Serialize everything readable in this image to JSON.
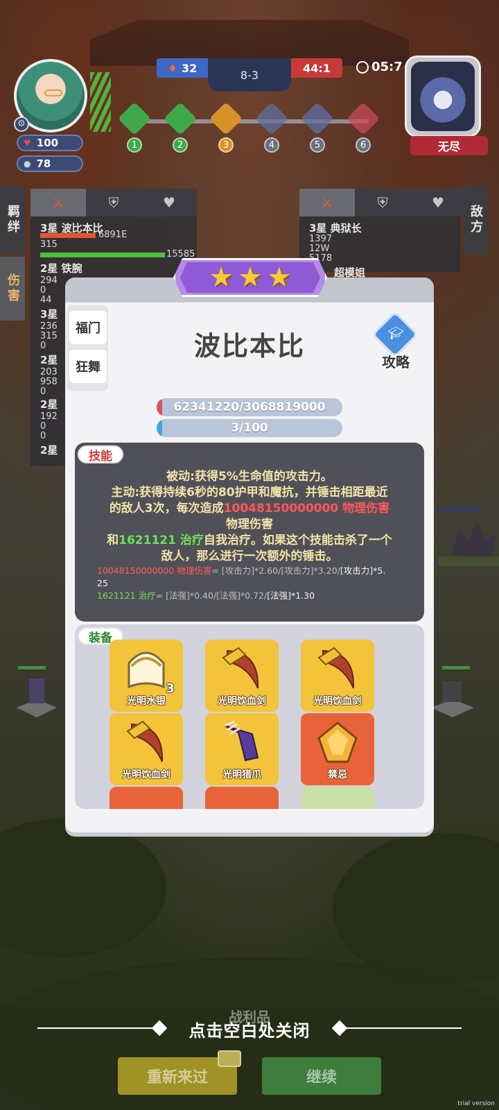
{
  "hud": {
    "player": {
      "hp": "100",
      "coins": "78"
    },
    "score": {
      "left": "32",
      "round": "8-3",
      "right": "44:1"
    },
    "timer": "05:7",
    "stages": [
      {
        "num": "1",
        "color": "#3fa84a",
        "done": true
      },
      {
        "num": "2",
        "color": "#3fa84a",
        "done": true
      },
      {
        "num": "3",
        "color": "#d8922a",
        "done": true
      },
      {
        "num": "4",
        "color": "#5f6fa0",
        "done": false
      },
      {
        "num": "5",
        "color": "#5f6fa0",
        "done": false
      },
      {
        "num": "6",
        "color": "#c74a5a",
        "done": false
      }
    ],
    "boss_label": "无尽"
  },
  "sidebar": {
    "left_tabs": [
      "羁绊",
      "伤害"
    ],
    "right_tab": "敌方"
  },
  "left_panel": {
    "rows": [
      {
        "title": "3星 波比本比",
        "nums": [
          "6891E",
          "315",
          "15585"
        ]
      },
      {
        "title": "2星 铁腕",
        "nums": [
          "294",
          "0",
          "44"
        ]
      },
      {
        "title": "3星",
        "nums": [
          "236",
          "315",
          "0"
        ]
      },
      {
        "title": "2星",
        "nums": [
          "203",
          "958",
          "0"
        ]
      },
      {
        "title": "2星",
        "nums": [
          "192",
          "0",
          "0"
        ]
      },
      {
        "title": "2星",
        "nums": []
      }
    ]
  },
  "right_panel": {
    "rows": [
      {
        "title": "3星 典狱长",
        "nums": [
          "1397",
          "12W",
          "5178"
        ]
      },
      {
        "title": "超模姐",
        "nums": []
      }
    ]
  },
  "modal": {
    "stars": 3,
    "traits": [
      "福门",
      "狂舞"
    ],
    "hero_name": "波比本比",
    "guide_label": "攻略",
    "hp_text": "62341220/3068819000",
    "hp_fraction": 0.02,
    "mana_text": "3/100",
    "mana_fraction": 0.03,
    "skill": {
      "tag": "技能",
      "line1": "被动:获得5%生命值的攻击力。",
      "line2": "主动:获得持续6秒的80护甲和魔抗，并锤击相距最近",
      "line3_a": "的敌人3次，每次造成",
      "line3_dmg": "10048150000000 物理伤害",
      "line4": "物理伤害",
      "line5_a": "和",
      "line5_heal": "1621121 治疗",
      "line5_b": "自我治疗。如果这个技能击杀了一个",
      "line6": "敌人，那么进行一次额外的锤击。",
      "formula1_val": "10048150000000 物理伤害",
      "formula1_eq": "= [攻击力]*2.60/[攻击力]*3.20/",
      "formula1_end": "[攻击力]*5.",
      "formula1_wrap": "25",
      "formula2_val": "1621121 治疗",
      "formula2_eq": "= [法强]*0.40/[法强]*0.72/",
      "formula2_end": "[法强]*1.30"
    },
    "equip": {
      "tag": "装备",
      "items": [
        {
          "name": "光明水银",
          "badge": "3"
        },
        {
          "name": "光明饮血剑",
          "badge": ""
        },
        {
          "name": "光明饮血剑",
          "badge": ""
        },
        {
          "name": "光明饮血剑",
          "badge": ""
        },
        {
          "name": "光明猎爪",
          "badge": ""
        },
        {
          "name": "禁忌",
          "badge": ""
        }
      ]
    }
  },
  "bottom": {
    "close_hint": "点击空白处关闭",
    "loot_label": "战利品",
    "retry": "重新来过",
    "continue": "继续",
    "trial": "trial version"
  }
}
